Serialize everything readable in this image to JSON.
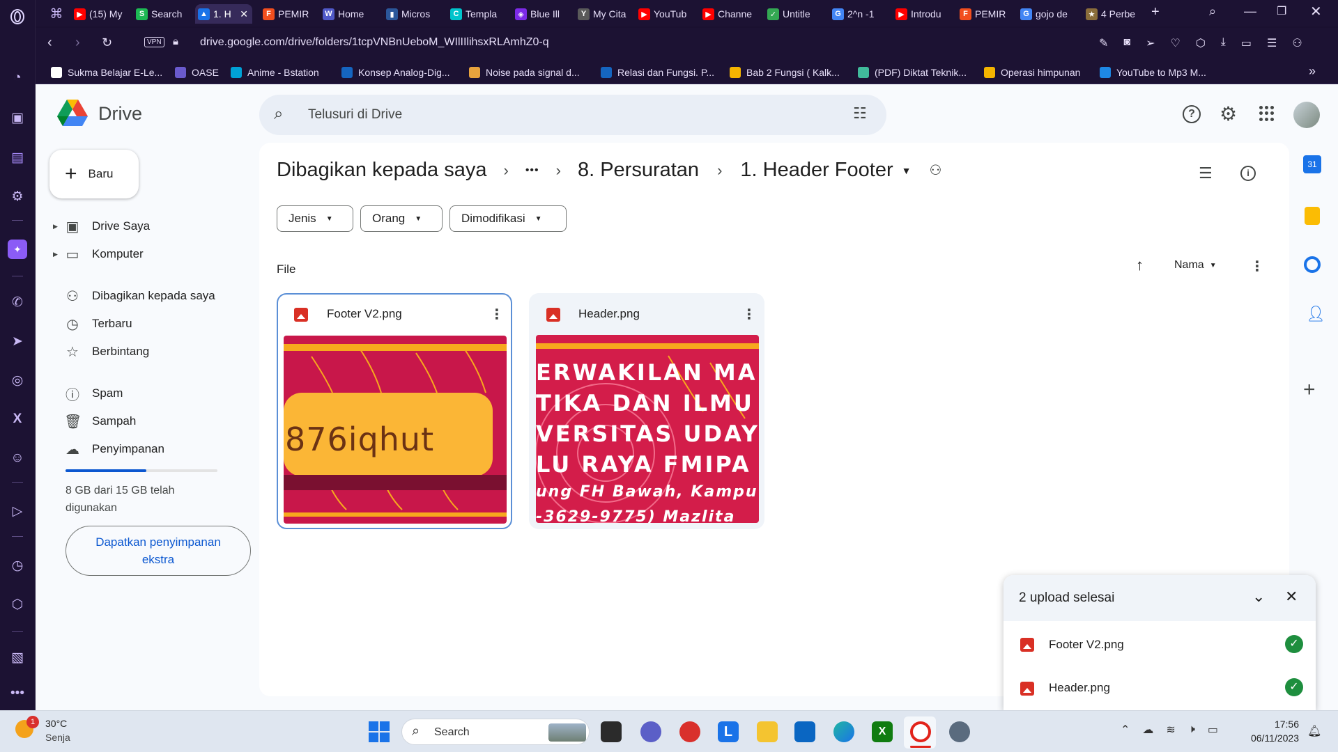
{
  "tabs": [
    {
      "label": "(15) My",
      "color": "#ff0000",
      "glyph": "▶"
    },
    {
      "label": "Search",
      "color": "#1db954",
      "glyph": "S"
    },
    {
      "label": "1. H",
      "color": "#1a73e8",
      "glyph": "▲",
      "active": true
    },
    {
      "label": "PEMIR",
      "color": "#f24e1e",
      "glyph": "F"
    },
    {
      "label": "Home",
      "color": "#5059c9",
      "glyph": "W"
    },
    {
      "label": "Micros",
      "color": "#2b579a",
      "glyph": "▮"
    },
    {
      "label": "Templa",
      "color": "#00c4cc",
      "glyph": "C"
    },
    {
      "label": "Blue Ill",
      "color": "#7d2ae8",
      "glyph": "◈"
    },
    {
      "label": "My Cita",
      "color": "#5a5a5a",
      "glyph": "Y"
    },
    {
      "label": "YouTub",
      "color": "#ff0000",
      "glyph": "▶"
    },
    {
      "label": "Channe",
      "color": "#ff0000",
      "glyph": "▶"
    },
    {
      "label": "Untitle",
      "color": "#34a853",
      "glyph": "✓"
    },
    {
      "label": "2^n -1",
      "color": "#4285f4",
      "glyph": "G"
    },
    {
      "label": "Introdu",
      "color": "#ff0000",
      "glyph": "▶"
    },
    {
      "label": "PEMIR",
      "color": "#f24e1e",
      "glyph": "F"
    },
    {
      "label": "gojo de",
      "color": "#4285f4",
      "glyph": "G"
    },
    {
      "label": "4 Perbe",
      "color": "#8a6d3b",
      "glyph": "★"
    }
  ],
  "address": {
    "url": "drive.google.com/drive/folders/1tcpVNBnUeboM_WIlIIlihsxRLAmhZ0-q",
    "vpn": "VPN"
  },
  "bookmarks": [
    {
      "label": "Sukma Belajar E-Le...",
      "color": "#ffffff"
    },
    {
      "label": "OASE",
      "color": "#6a5acd"
    },
    {
      "label": "Anime - Bstation",
      "color": "#00a1d6"
    },
    {
      "label": "Konsep Analog-Dig...",
      "color": "#1565c0"
    },
    {
      "label": "Noise pada signal d...",
      "color": "#e8a33d"
    },
    {
      "label": "Relasi dan Fungsi. P...",
      "color": "#1565c0"
    },
    {
      "label": "Bab 2 Fungsi ( Kalk...",
      "color": "#f4b400"
    },
    {
      "label": "(PDF) Diktat Teknik...",
      "color": "#40ba9b"
    },
    {
      "label": "Operasi himpunan",
      "color": "#f4b400"
    },
    {
      "label": "YouTube to Mp3 M...",
      "color": "#1e88e5"
    }
  ],
  "drive": {
    "product": "Drive",
    "search_placeholder": "Telusuri di Drive",
    "new_button": "Baru",
    "nav": {
      "my_drive": "Drive Saya",
      "computers": "Komputer",
      "shared": "Dibagikan kepada saya",
      "recent": "Terbaru",
      "starred": "Berbintang",
      "spam": "Spam",
      "trash": "Sampah",
      "storage": "Penyimpanan"
    },
    "storage_text": "8 GB dari 15 GB telah digunakan",
    "storage_used_fraction": 0.53,
    "get_storage_line1": "Dapatkan penyimpanan",
    "get_storage_line2": "ekstra",
    "breadcrumb": {
      "root": "Dibagikan kepada saya",
      "ellipsis": "•••",
      "mid": "8. Persuratan",
      "current": "1. Header Footer"
    },
    "filters": [
      "Jenis",
      "Orang",
      "Dimodifikasi"
    ],
    "section_label": "File",
    "sort_label": "Nama",
    "files": [
      {
        "name": "Footer V2.png",
        "thumb_text": "876iqhut"
      },
      {
        "name": "Header.png",
        "thumb_lines": [
          "ERWAKILAN MA",
          "TIKA DAN ILMU P",
          "VERSITAS UDAY",
          "LU RAYA FMIPA",
          "ung FH Bawah, Kampu",
          "-3629-9775) Mazlita"
        ]
      }
    ]
  },
  "upload": {
    "title": "2 upload selesai",
    "items": [
      "Footer V2.png",
      "Header.png"
    ]
  },
  "taskbar": {
    "temperature": "30°C",
    "weather": "Senja",
    "weather_badge": "1",
    "search": "Search",
    "time": "17:56",
    "date": "06/11/2023"
  }
}
